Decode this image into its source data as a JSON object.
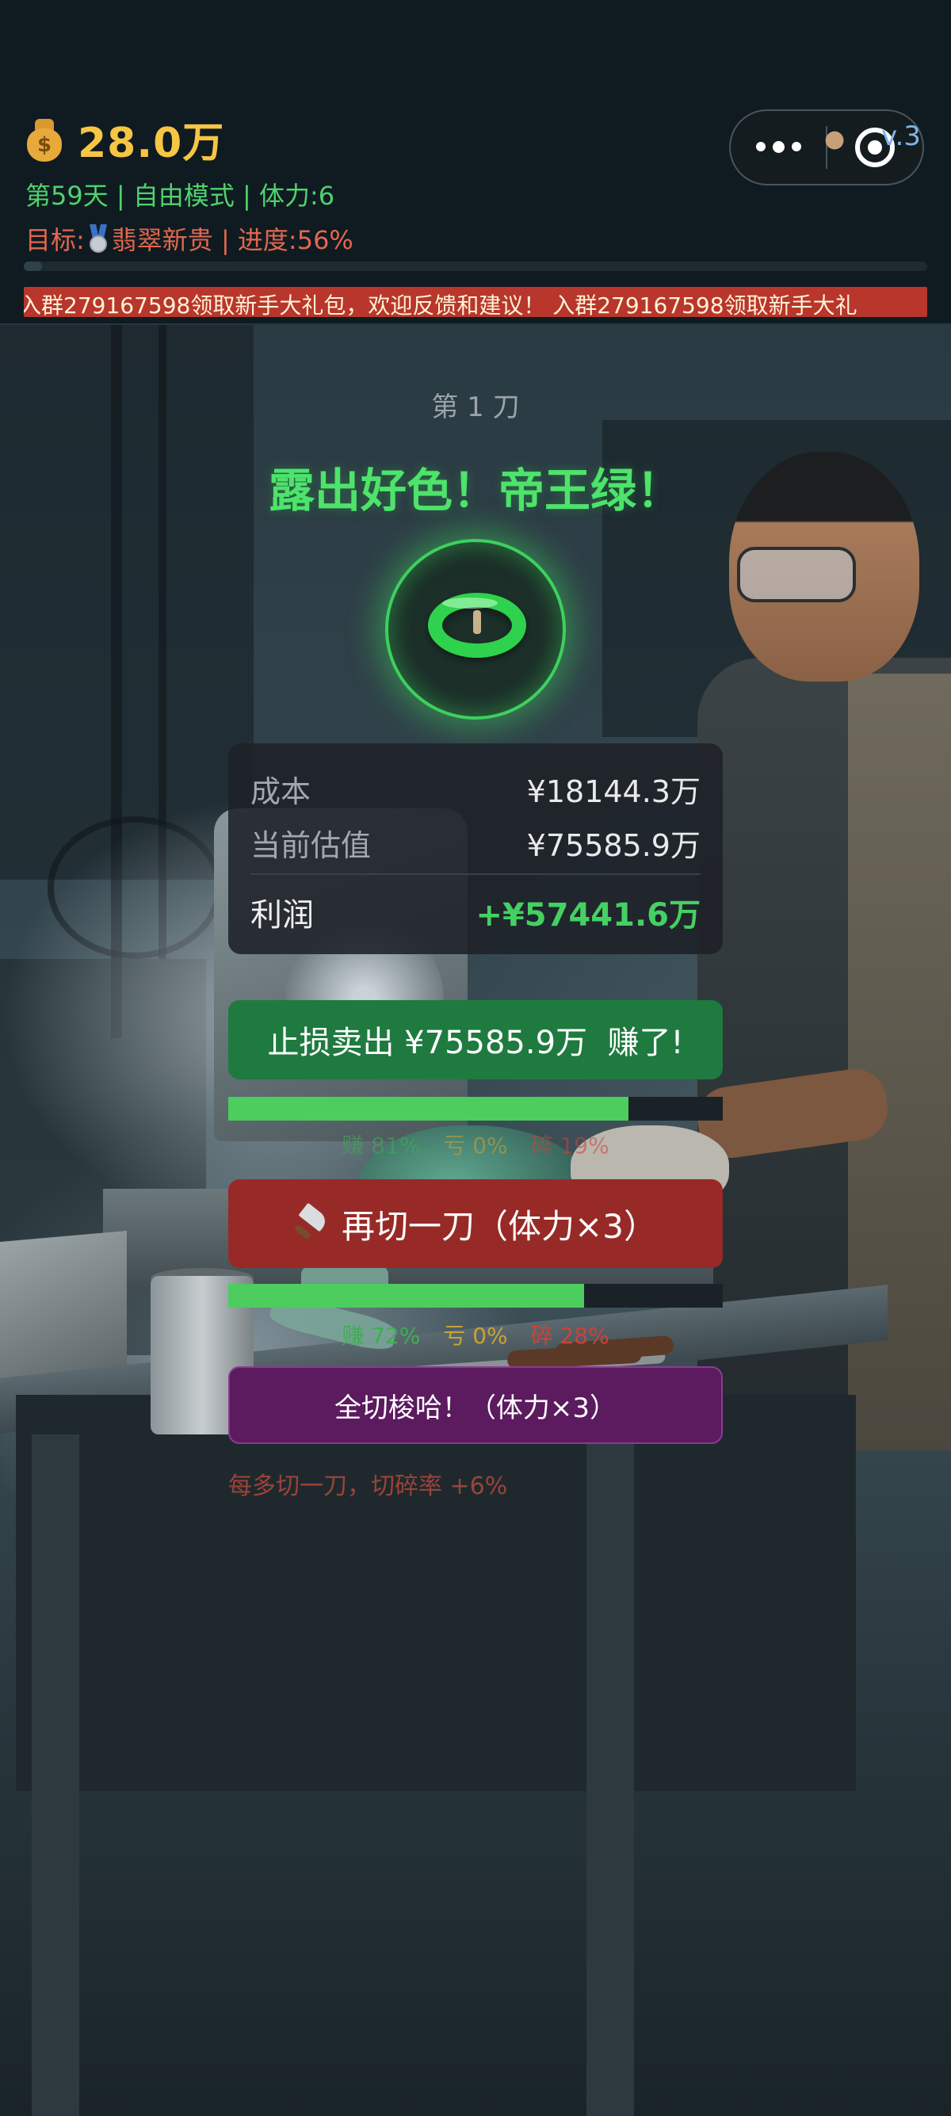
{
  "header": {
    "money": "28.0万",
    "status": "第59天 | 自由模式 | 体力:6",
    "goal_prefix": "目标:",
    "goal_suffix": "翡翠新贵 | 进度:56%",
    "progress_fraction": 0.02,
    "marquee": "入群279167598领取新手大礼包，欢迎反馈和建议！ 入群279167598领取新手大礼",
    "version": "v.3"
  },
  "icons": {
    "money": "money-bag-icon",
    "goal": "medal-icon",
    "jade": "jade-bangle-icon",
    "cut": "knife-icon",
    "menu": "more-icon",
    "close": "close-icon",
    "eye": "eye-icon"
  },
  "game": {
    "cut_count": "第 1 刀",
    "result": "露出好色！帝王绿！",
    "card": {
      "cost_label": "成本",
      "cost_value": "¥18144.3万",
      "estimate_label": "当前估值",
      "estimate_value": "¥75585.9万",
      "profit_label": "利润",
      "profit_value": "+¥57441.6万"
    },
    "sell_button": "止损卖出 ¥75585.9万  赚了!",
    "sell_odds": {
      "win_fraction": 0.81,
      "win": "赚 81%",
      "lose": "亏 0%",
      "break": "碎 19%"
    },
    "cut_button": "再切一刀（体力×3）",
    "cut_odds": {
      "win_fraction": 0.72,
      "win": "赚 72%",
      "lose": "亏 0%",
      "break": "碎 28%"
    },
    "full_cut_button": "全切梭哈！（体力×3）",
    "warning": "每多切一刀，切碎率 +6%"
  },
  "colors": {
    "money": "#f6c544",
    "status": "#4fd36d",
    "goal": "#e2674f",
    "marquee_bg": "#b8362b",
    "sell_button": "#1f7a3f",
    "cut_button": "#972a27",
    "full_cut_button": "#5c1a5f",
    "profit": "#45d063",
    "jade": "#2fd24c"
  }
}
